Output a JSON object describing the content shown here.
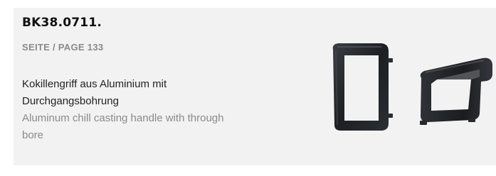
{
  "product": {
    "sku": "BK38.0711.",
    "page_ref": "SEITE / PAGE 133",
    "description_de": "Kokillengriff aus Aluminium mit Durchgangsbohrung",
    "description_en": "Aluminum chill casting handle with through bore",
    "image_icon": "chill-casting-handle-image"
  },
  "colors": {
    "panel_background": "#f2f2f2",
    "sku_text": "#111111",
    "muted_text": "#8a8a8a",
    "body_text": "#222222",
    "product_metal": "#1d1f22"
  }
}
